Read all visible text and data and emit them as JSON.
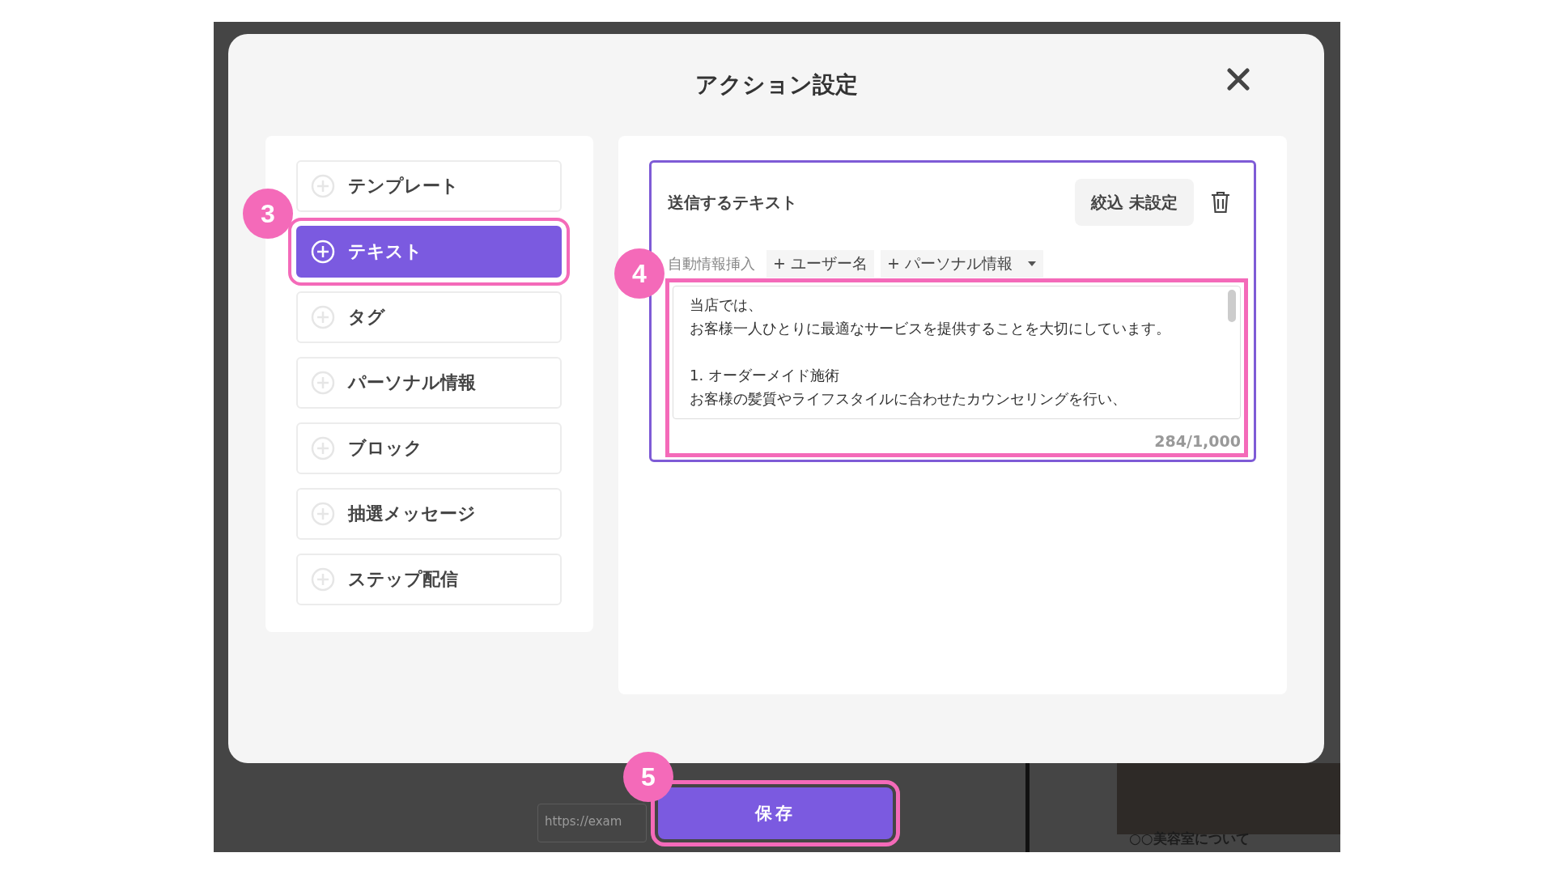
{
  "dialog": {
    "title": "アクション設定"
  },
  "action_types": [
    {
      "label": "テンプレート",
      "selected": false
    },
    {
      "label": "テキスト",
      "selected": true,
      "annotation": "3"
    },
    {
      "label": "タグ",
      "selected": false
    },
    {
      "label": "パーソナル情報",
      "selected": false
    },
    {
      "label": "ブロック",
      "selected": false
    },
    {
      "label": "抽選メッセージ",
      "selected": false
    },
    {
      "label": "ステップ配信",
      "selected": false
    }
  ],
  "text_card": {
    "title": "送信するテキスト",
    "filter_button": "絞込 未設定",
    "auto_insert_label": "自動情報挿入",
    "insert_buttons": [
      {
        "label": "+ ユーザー名",
        "kind": "button"
      },
      {
        "label": "+ パーソナル情報",
        "kind": "dropdown"
      }
    ],
    "message_lines": [
      "当店では、",
      "お客様一人ひとりに最適なサービスを提供することを大切にしています。",
      "1. オーダーメイド施術",
      "お客様の髪質やライフスタイルに合わせたカウンセリングを行い、"
    ],
    "char_count": "284/1,000",
    "annotation": "4"
  },
  "save_button": {
    "label": "保存",
    "annotation": "5"
  },
  "background": {
    "url_placeholder": "https://exam",
    "article_title": "○○美容室について"
  }
}
